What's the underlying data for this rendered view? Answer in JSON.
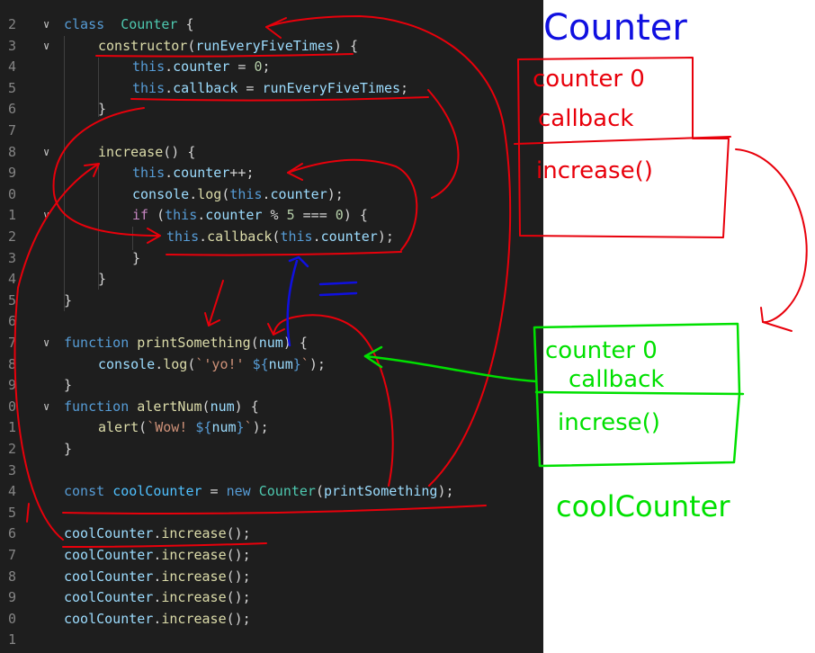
{
  "code_lines": [
    {
      "n": "2",
      "fold": "v",
      "indent": 0,
      "tokens": [
        [
          "kw",
          "class"
        ],
        [
          "",
          "  "
        ],
        [
          "cls",
          "Counter"
        ],
        [
          "punc",
          " {"
        ]
      ]
    },
    {
      "n": "3",
      "fold": "v",
      "indent": 1,
      "tokens": [
        [
          "fn",
          "constructor"
        ],
        [
          "punc",
          "("
        ],
        [
          "var",
          "runEveryFiveTimes"
        ],
        [
          "punc",
          ") {"
        ]
      ]
    },
    {
      "n": "4",
      "fold": "",
      "indent": 2,
      "tokens": [
        [
          "kw",
          "this"
        ],
        [
          "punc",
          "."
        ],
        [
          "var",
          "counter"
        ],
        [
          "op",
          " = "
        ],
        [
          "num",
          "0"
        ],
        [
          "punc",
          ";"
        ]
      ]
    },
    {
      "n": "5",
      "fold": "",
      "indent": 2,
      "tokens": [
        [
          "kw",
          "this"
        ],
        [
          "punc",
          "."
        ],
        [
          "var",
          "callback"
        ],
        [
          "op",
          " = "
        ],
        [
          "var",
          "runEveryFiveTimes"
        ],
        [
          "punc",
          ";"
        ]
      ]
    },
    {
      "n": "6",
      "fold": "",
      "indent": 1,
      "tokens": [
        [
          "punc",
          "}"
        ]
      ]
    },
    {
      "n": "7",
      "fold": "",
      "indent": 0,
      "tokens": []
    },
    {
      "n": "8",
      "fold": "v",
      "indent": 1,
      "tokens": [
        [
          "fn",
          "increase"
        ],
        [
          "punc",
          "() {"
        ]
      ]
    },
    {
      "n": "9",
      "fold": "",
      "indent": 2,
      "tokens": [
        [
          "kw",
          "this"
        ],
        [
          "punc",
          "."
        ],
        [
          "var",
          "counter"
        ],
        [
          "op",
          "++"
        ],
        [
          "punc",
          ";"
        ]
      ]
    },
    {
      "n": "0",
      "fold": "",
      "indent": 2,
      "tokens": [
        [
          "var",
          "console"
        ],
        [
          "punc",
          "."
        ],
        [
          "fn",
          "log"
        ],
        [
          "punc",
          "("
        ],
        [
          "kw",
          "this"
        ],
        [
          "punc",
          "."
        ],
        [
          "var",
          "counter"
        ],
        [
          "punc",
          ");"
        ]
      ]
    },
    {
      "n": "1",
      "fold": "v",
      "indent": 2,
      "tokens": [
        [
          "kw2",
          "if"
        ],
        [
          "punc",
          " ("
        ],
        [
          "kw",
          "this"
        ],
        [
          "punc",
          "."
        ],
        [
          "var",
          "counter"
        ],
        [
          "op",
          " % "
        ],
        [
          "num",
          "5"
        ],
        [
          "op",
          " === "
        ],
        [
          "num",
          "0"
        ],
        [
          "punc",
          ") {"
        ]
      ]
    },
    {
      "n": "2",
      "fold": "",
      "indent": 3,
      "tokens": [
        [
          "kw",
          "this"
        ],
        [
          "punc",
          "."
        ],
        [
          "fn",
          "callback"
        ],
        [
          "punc",
          "("
        ],
        [
          "kw",
          "this"
        ],
        [
          "punc",
          "."
        ],
        [
          "var",
          "counter"
        ],
        [
          "punc",
          ");"
        ]
      ]
    },
    {
      "n": "3",
      "fold": "",
      "indent": 2,
      "tokens": [
        [
          "punc",
          "}"
        ]
      ]
    },
    {
      "n": "4",
      "fold": "",
      "indent": 1,
      "tokens": [
        [
          "punc",
          "}"
        ]
      ]
    },
    {
      "n": "5",
      "fold": "",
      "indent": 0,
      "tokens": [
        [
          "punc",
          "}"
        ]
      ]
    },
    {
      "n": "6",
      "fold": "",
      "indent": 0,
      "tokens": []
    },
    {
      "n": "7",
      "fold": "v",
      "indent": 0,
      "tokens": [
        [
          "kw",
          "function"
        ],
        [
          "punc",
          " "
        ],
        [
          "fn",
          "printSomething"
        ],
        [
          "punc",
          "("
        ],
        [
          "var",
          "num"
        ],
        [
          "punc",
          ") {"
        ]
      ]
    },
    {
      "n": "8",
      "fold": "",
      "indent": 1,
      "tokens": [
        [
          "var",
          "console"
        ],
        [
          "punc",
          "."
        ],
        [
          "fn",
          "log"
        ],
        [
          "punc",
          "("
        ],
        [
          "str",
          "`'yo!' "
        ],
        [
          "kw",
          "${"
        ],
        [
          "var",
          "num"
        ],
        [
          "kw",
          "}"
        ],
        [
          "str",
          "`"
        ],
        [
          "punc",
          ");"
        ]
      ]
    },
    {
      "n": "9",
      "fold": "",
      "indent": 0,
      "tokens": [
        [
          "punc",
          "}"
        ]
      ]
    },
    {
      "n": "0",
      "fold": "v",
      "indent": 0,
      "tokens": [
        [
          "kw",
          "function"
        ],
        [
          "punc",
          " "
        ],
        [
          "fn",
          "alertNum"
        ],
        [
          "punc",
          "("
        ],
        [
          "var",
          "num"
        ],
        [
          "punc",
          ") {"
        ]
      ]
    },
    {
      "n": "1",
      "fold": "",
      "indent": 1,
      "tokens": [
        [
          "fn",
          "alert"
        ],
        [
          "punc",
          "("
        ],
        [
          "str",
          "`Wow! "
        ],
        [
          "kw",
          "${"
        ],
        [
          "var",
          "num"
        ],
        [
          "kw",
          "}"
        ],
        [
          "str",
          "`"
        ],
        [
          "punc",
          ");"
        ]
      ]
    },
    {
      "n": "2",
      "fold": "",
      "indent": 0,
      "tokens": [
        [
          "punc",
          "}"
        ]
      ]
    },
    {
      "n": "3",
      "fold": "",
      "indent": 0,
      "tokens": []
    },
    {
      "n": "4",
      "fold": "",
      "indent": 0,
      "tokens": [
        [
          "kw",
          "const"
        ],
        [
          "punc",
          " "
        ],
        [
          "cn",
          "coolCounter"
        ],
        [
          "op",
          " = "
        ],
        [
          "kw",
          "new"
        ],
        [
          "punc",
          " "
        ],
        [
          "cls",
          "Counter"
        ],
        [
          "punc",
          "("
        ],
        [
          "var",
          "printSomething"
        ],
        [
          "punc",
          ");"
        ]
      ]
    },
    {
      "n": "5",
      "fold": "",
      "indent": 0,
      "tokens": []
    },
    {
      "n": "6",
      "fold": "",
      "indent": 0,
      "tokens": [
        [
          "var",
          "coolCounter"
        ],
        [
          "punc",
          "."
        ],
        [
          "fn",
          "increase"
        ],
        [
          "punc",
          "();"
        ]
      ]
    },
    {
      "n": "7",
      "fold": "",
      "indent": 0,
      "tokens": [
        [
          "var",
          "coolCounter"
        ],
        [
          "punc",
          "."
        ],
        [
          "fn",
          "increase"
        ],
        [
          "punc",
          "();"
        ]
      ]
    },
    {
      "n": "8",
      "fold": "",
      "indent": 0,
      "tokens": [
        [
          "var",
          "coolCounter"
        ],
        [
          "punc",
          "."
        ],
        [
          "fn",
          "increase"
        ],
        [
          "punc",
          "();"
        ]
      ]
    },
    {
      "n": "9",
      "fold": "",
      "indent": 0,
      "tokens": [
        [
          "var",
          "coolCounter"
        ],
        [
          "punc",
          "."
        ],
        [
          "fn",
          "increase"
        ],
        [
          "punc",
          "();"
        ]
      ]
    },
    {
      "n": "0",
      "fold": "",
      "indent": 0,
      "tokens": [
        [
          "var",
          "coolCounter"
        ],
        [
          "punc",
          "."
        ],
        [
          "fn",
          "increase"
        ],
        [
          "punc",
          "();"
        ]
      ]
    },
    {
      "n": "1",
      "fold": "",
      "indent": 0,
      "tokens": []
    }
  ],
  "annotations": {
    "class_title": "Counter",
    "class_box_fields": [
      "counter 0",
      "callback"
    ],
    "class_box_methods": "increase()",
    "instance_box_fields": [
      "counter 0",
      "callback"
    ],
    "instance_box_methods": "increse()",
    "instance_name": "coolCounter",
    "equals_sign": "="
  },
  "colors": {
    "editor_bg": "#1e1e1e",
    "red_ink": "#e8000b",
    "blue_ink": "#1010e0",
    "green_ink": "#00e000"
  }
}
